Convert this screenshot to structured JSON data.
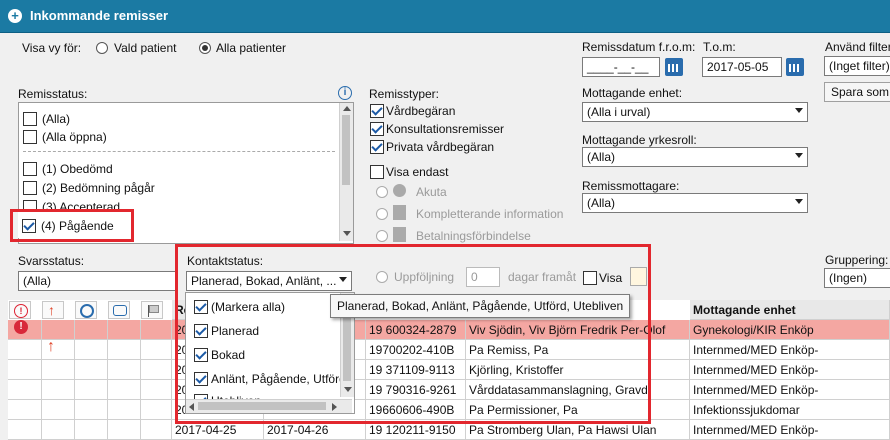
{
  "window": {
    "title": "Inkommande remisser"
  },
  "view": {
    "label": "Visa vy för:",
    "option_selected": "Vald patient",
    "option_all": "Alla patienter"
  },
  "dates": {
    "from_label": "Remissdatum f.r.o.m:",
    "from_value": "____-__-__",
    "to_label": "T.o.m:",
    "to_value": "2017-05-05"
  },
  "filter": {
    "label": "Använd filter",
    "value": "(Inget filter)",
    "save_button": "Spara som"
  },
  "remisstatus": {
    "label": "Remisstatus:",
    "items": [
      {
        "label": "(Alla)",
        "checked": false
      },
      {
        "label": "(Alla öppna)",
        "checked": false
      },
      {
        "label": "(1) Obedömd",
        "checked": false
      },
      {
        "label": "(2) Bedömning pågår",
        "checked": false
      },
      {
        "label": "(3) Accepterad",
        "checked": false
      },
      {
        "label": "(4) Pågående",
        "checked": true
      }
    ]
  },
  "remisstyper": {
    "label": "Remisstyper:",
    "items": [
      {
        "label": "Vårdbegäran",
        "checked": true
      },
      {
        "label": "Konsultationsremisser",
        "checked": true
      },
      {
        "label": "Privata vårdbegäran",
        "checked": true
      }
    ],
    "visa_endast": {
      "label": "Visa endast",
      "checked": false
    },
    "options": [
      "Akuta",
      "Kompletterande information",
      "Betalningsförbindelse"
    ],
    "uppfoljning": {
      "label": "Uppföljning",
      "value": "0",
      "suffix": "dagar framåt",
      "visa_label": "Visa"
    }
  },
  "mottagande_enhet": {
    "label": "Mottagande enhet:",
    "value": "(Alla i urval)"
  },
  "mottagande_yrkesroll": {
    "label": "Mottagande yrkesroll:",
    "value": "(Alla)"
  },
  "remissmottagare": {
    "label": "Remissmottagare:",
    "value": "(Alla)"
  },
  "svarsstatus": {
    "label": "Svarsstatus:",
    "value": "(Alla)"
  },
  "gruppering": {
    "label": "Gruppering:",
    "value": "(Ingen)"
  },
  "kontaktstatus": {
    "label": "Kontaktstatus:",
    "value": "Planerad, Bokad, Anlänt, ...",
    "items": [
      {
        "label": "(Markera alla)",
        "checked": true
      },
      {
        "label": "Planerad",
        "checked": true
      },
      {
        "label": "Bokad",
        "checked": true
      },
      {
        "label": "Anlänt, Pågående, Utförd",
        "checked": true
      },
      {
        "label": "Utebliven",
        "checked": true
      }
    ],
    "tooltip": "Planerad, Bokad, Anlänt, Pågående, Utförd, Utebliven"
  },
  "table": {
    "headers": {
      "date1": "Re",
      "pnr": "",
      "name": "",
      "unit": "Mottagande enhet"
    },
    "rows": [
      {
        "date1": "20",
        "date2": "",
        "pnr": "19 600324-2879",
        "name": "Viv Sjödin, Viv Björn Fredrik Per-Olof",
        "unit": "Gynekologi/KIR Enköp",
        "selected": true
      },
      {
        "date1": "20",
        "date2": "",
        "pnr": "19700202-410B",
        "name": "Pa Remiss, Pa",
        "unit": "Internmed/MED Enköp-",
        "selected": false
      },
      {
        "date1": "20",
        "date2": "",
        "pnr": "19 371109-9113",
        "name": "Kjörling, Kristoffer",
        "unit": "Internmed/MED Enköp-",
        "selected": false
      },
      {
        "date1": "20",
        "date2": "",
        "pnr": "19 790316-9261",
        "name": "Vårddatasammanslagning, Gravd",
        "unit": "Internmed/MED Enköp-",
        "selected": false
      },
      {
        "date1": "20",
        "date2": "",
        "pnr": "19660606-490B",
        "name": "Pa Permissioner, Pa",
        "unit": "Infektionssjukdomar",
        "selected": false
      },
      {
        "date1": "2017-04-25",
        "date2": "2017-04-26",
        "pnr": "19 120211-9150",
        "name": "Pa Stromberg Ulan, Pa Hawsi Ulan",
        "unit": "Internmed/MED Enköp-",
        "selected": false
      }
    ]
  },
  "colors": {
    "titlebar": "#1b7aa3",
    "highlight": "#e2272e",
    "selected_row": "#f4a7a2"
  }
}
